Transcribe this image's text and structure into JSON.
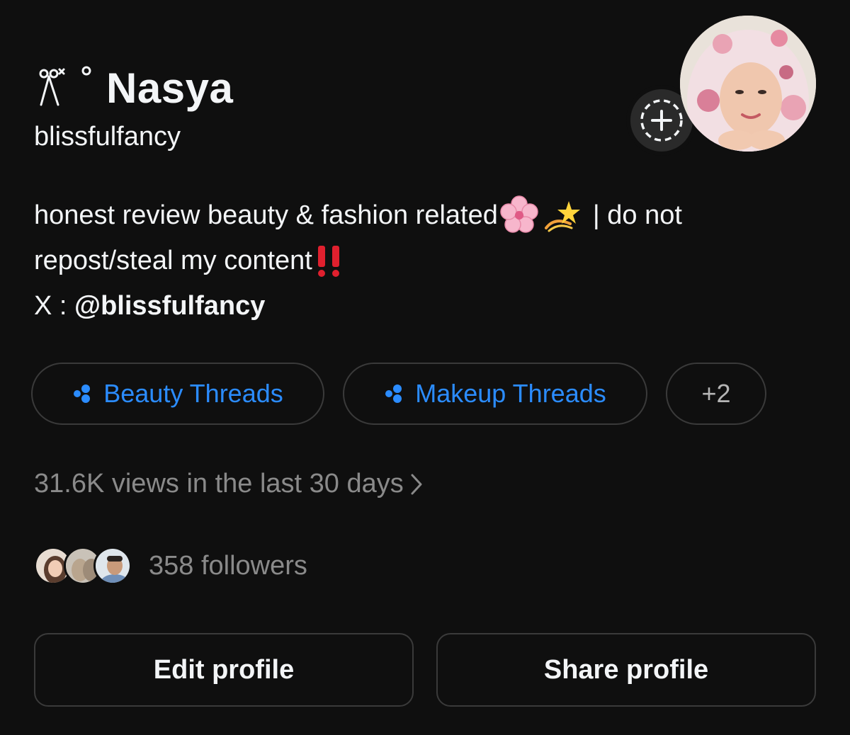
{
  "profile": {
    "display_name": "Nasya",
    "username": "blissfulfancy",
    "bio": {
      "line1_text": "honest review beauty & fashion related",
      "line1_suffix": "| do not",
      "line2_text": "repost/steal my content",
      "line3_prefix": "X : ",
      "line3_handle": "@blissfulfancy"
    }
  },
  "tags": [
    {
      "label": "Beauty Threads"
    },
    {
      "label": "Makeup Threads"
    },
    {
      "label": "+2"
    }
  ],
  "stats": {
    "views": "31.6K views in the last 30 days",
    "followers": "358 followers"
  },
  "actions": {
    "edit": "Edit profile",
    "share": "Share profile"
  },
  "colors": {
    "background": "#0f0f0f",
    "accent_blue": "#2b8cff",
    "muted": "#8a8a8a",
    "border": "#3a3a3a"
  },
  "icons": [
    "ribbon-ornament-icon",
    "story-add-icon",
    "cherry-blossom-emoji",
    "dizzy-emoji",
    "double-exclamation-emoji",
    "threads-tag-icon",
    "chevron-right-icon"
  ]
}
